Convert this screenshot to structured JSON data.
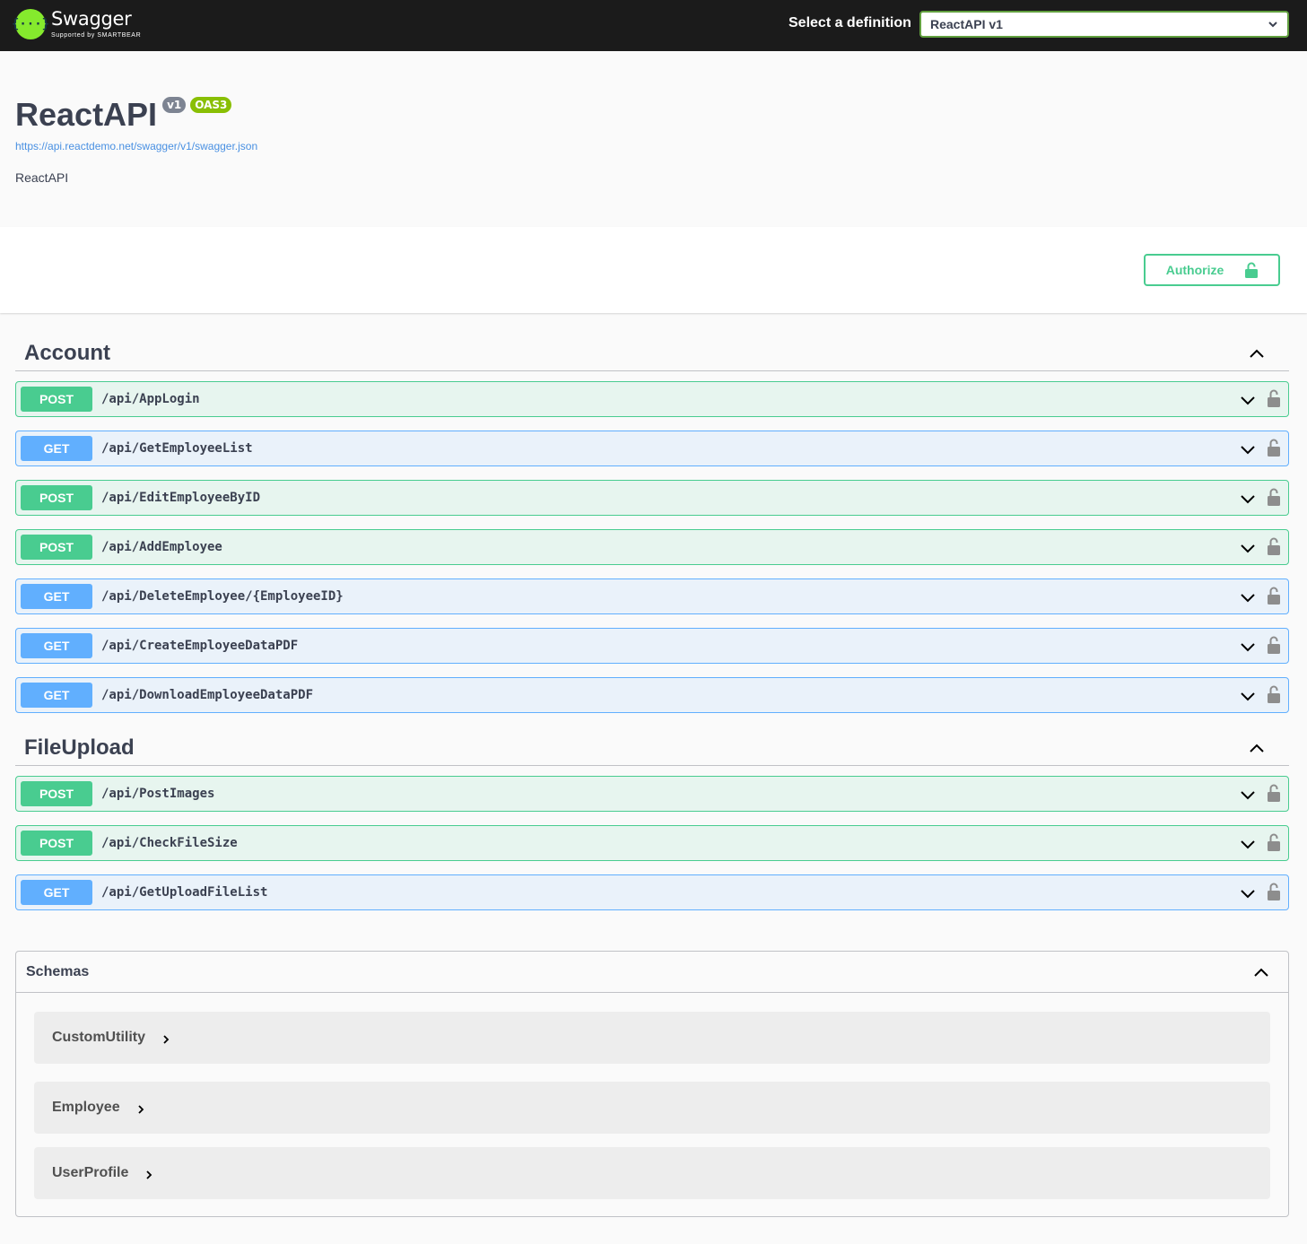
{
  "topbar": {
    "logo_glyph": "{···}",
    "logo_name": "Swagger",
    "logo_sub": "Supported by SMARTBEAR",
    "definition_label": "Select a definition",
    "definition_value": "ReactAPI v1"
  },
  "info": {
    "title": "ReactAPI",
    "version_badge": "v1",
    "oas_badge": "OAS3",
    "spec_url": "https://api.reactdemo.net/swagger/v1/swagger.json",
    "description": "ReactAPI"
  },
  "auth": {
    "label": "Authorize"
  },
  "tags": [
    {
      "name": "Account",
      "operations": [
        {
          "method": "POST",
          "path": "/api/AppLogin"
        },
        {
          "method": "GET",
          "path": "/api/GetEmployeeList"
        },
        {
          "method": "POST",
          "path": "/api/EditEmployeeByID"
        },
        {
          "method": "POST",
          "path": "/api/AddEmployee"
        },
        {
          "method": "GET",
          "path": "/api/DeleteEmployee/{EmployeeID}"
        },
        {
          "method": "GET",
          "path": "/api/CreateEmployeeDataPDF"
        },
        {
          "method": "GET",
          "path": "/api/DownloadEmployeeDataPDF"
        }
      ]
    },
    {
      "name": "FileUpload",
      "operations": [
        {
          "method": "POST",
          "path": "/api/PostImages"
        },
        {
          "method": "POST",
          "path": "/api/CheckFileSize"
        },
        {
          "method": "GET",
          "path": "/api/GetUploadFileList"
        }
      ]
    }
  ],
  "schemas": {
    "title": "Schemas",
    "models": [
      "CustomUtility",
      "Employee",
      "UserProfile"
    ]
  },
  "colors": {
    "post": "#49cc90",
    "get": "#61affe",
    "topbar": "#1b1b1b",
    "logo": "#85ea2d"
  },
  "icons": {
    "tag_toggle": "chevron-up-icon",
    "op_toggle": "chevron-down-icon",
    "op_lock": "unlocked-icon",
    "model_expand": "chevron-right-icon"
  }
}
